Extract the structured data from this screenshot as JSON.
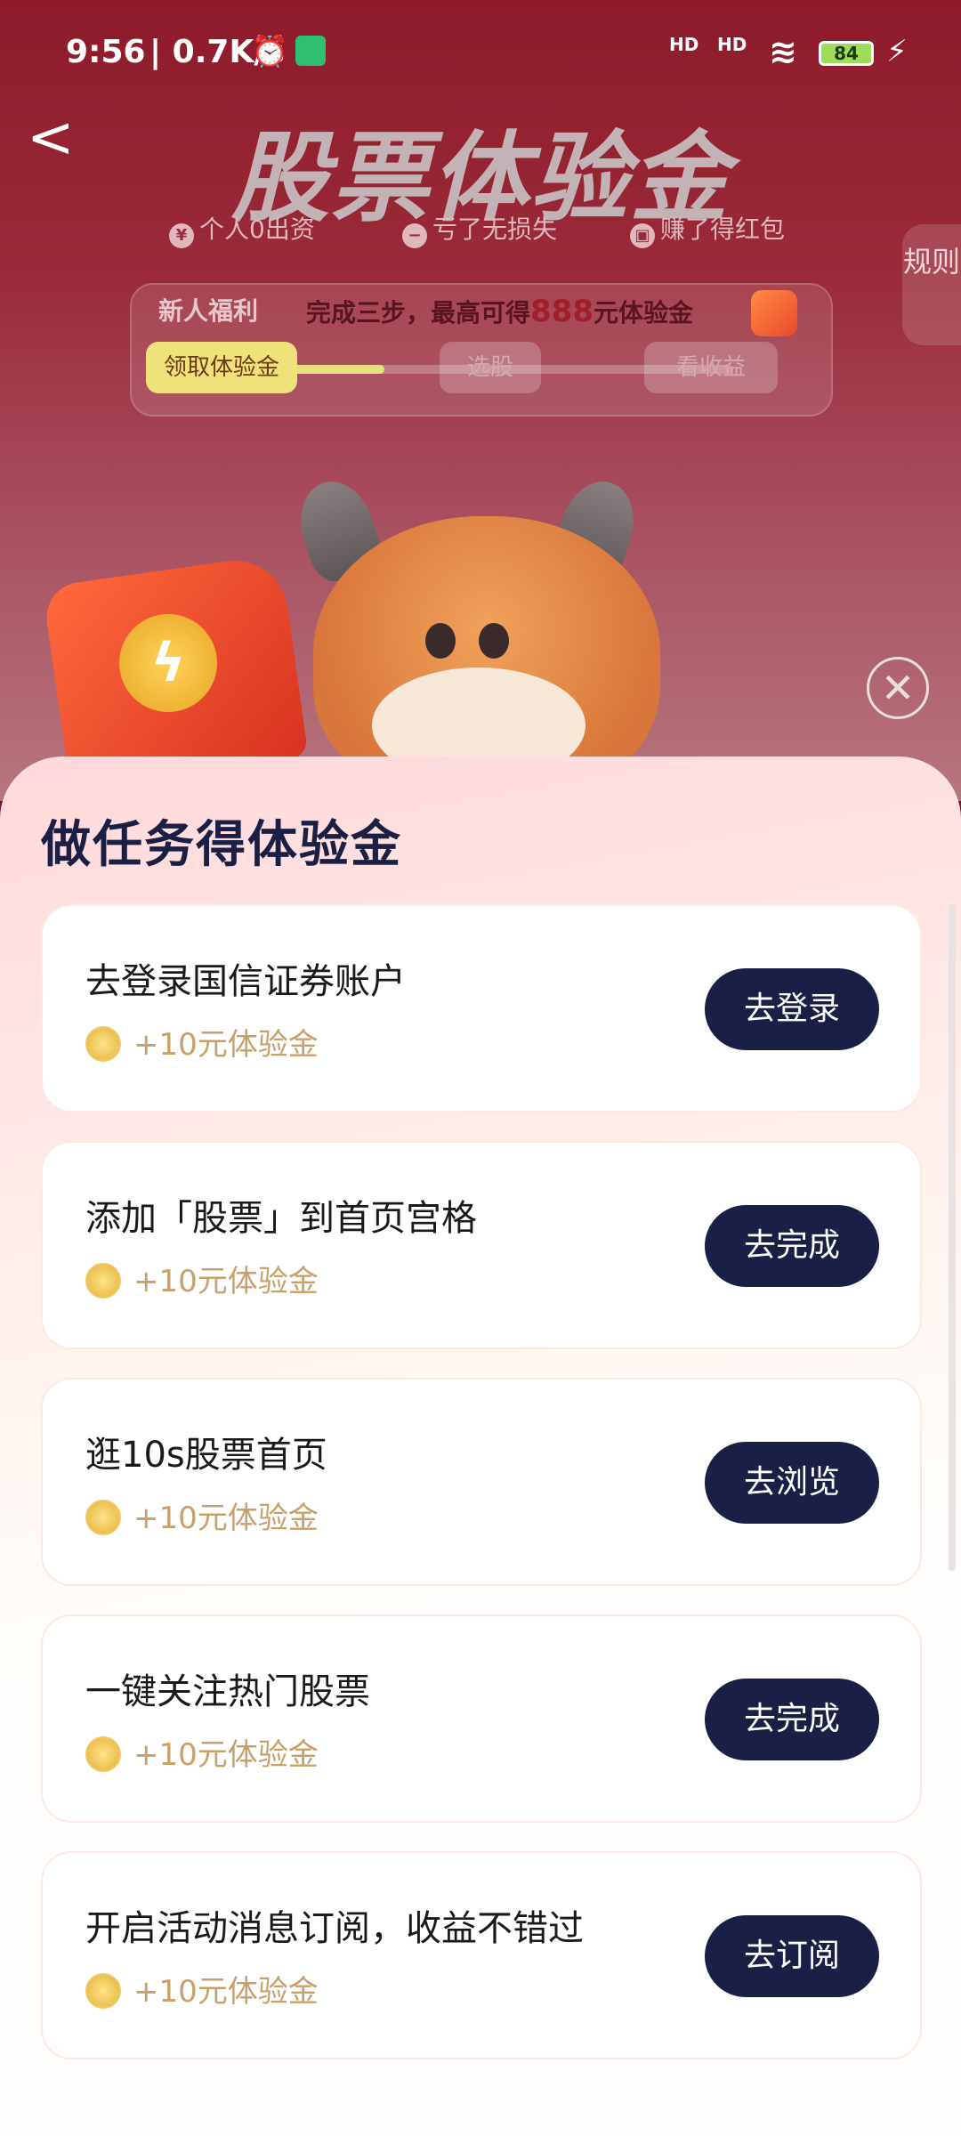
{
  "status_bar": {
    "time": "9:56",
    "net_speed": "| 0.7K/s",
    "signal1": "HD",
    "signal2": "HD",
    "battery": "84"
  },
  "header": {
    "back": "<",
    "title": "股票体验金",
    "perks": [
      "个人0出资",
      "亏了无损失",
      "赚了得红包"
    ],
    "rules_label": "规则"
  },
  "welfare": {
    "tag": "新人福利",
    "headline_prefix": "完成三步，最高可得",
    "headline_amount": "888",
    "headline_suffix": "元体验金",
    "steps": [
      {
        "label": "领取体验金",
        "active": true
      },
      {
        "label": "选股",
        "active": false
      },
      {
        "label": "看收益",
        "active": false
      }
    ],
    "progress": 0.3
  },
  "sheet": {
    "title": "做任务得体验金",
    "tasks": [
      {
        "name": "去登录国信证券账户",
        "reward": "+10元体验金",
        "button": "去登录"
      },
      {
        "name": "添加「股票」到首页宫格",
        "reward": "+10元体验金",
        "button": "去完成"
      },
      {
        "name": "逛10s股票首页",
        "reward": "+10元体验金",
        "button": "去浏览"
      },
      {
        "name": "一键关注热门股票",
        "reward": "+10元体验金",
        "button": "去完成"
      },
      {
        "name": "开启活动消息订阅，收益不错过",
        "reward": "+10元体验金",
        "button": "去订阅"
      }
    ]
  },
  "colors": {
    "button_bg": "#1a1f45",
    "reward_text": "#c8a06a",
    "accent_red": "#a01f2c"
  }
}
